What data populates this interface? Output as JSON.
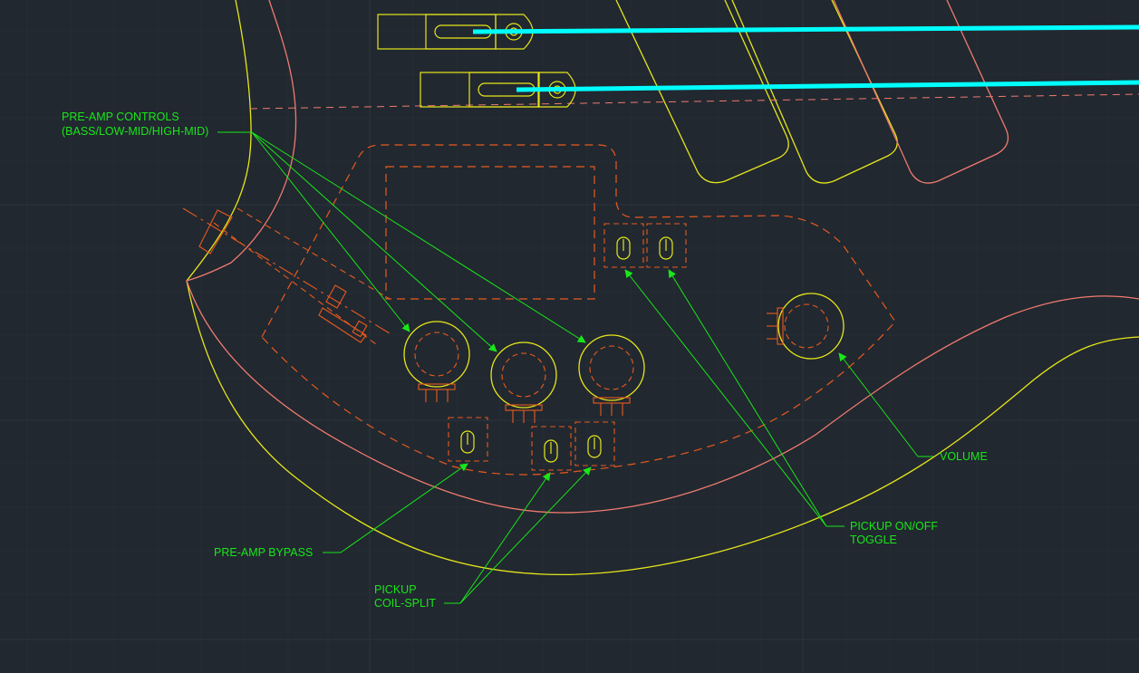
{
  "colors": {
    "background": "#212830",
    "grid": "#2c343d",
    "leader": "#19e619",
    "yellow": "#e6e619",
    "salmon": "#f07a6e",
    "orange": "#e85a1e",
    "cyan": "#00ffff"
  },
  "labels": {
    "preamp_controls_line1": "PRE-AMP CONTROLS",
    "preamp_controls_line2": "(BASS/LOW-MID/HIGH-MID)",
    "volume": "VOLUME",
    "pickup_toggle_line1": "PICKUP ON/OFF",
    "pickup_toggle_line2": "TOGGLE",
    "preamp_bypass": "PRE-AMP BYPASS",
    "coil_split_line1": "PICKUP",
    "coil_split_line2": "COIL-SPLIT"
  }
}
